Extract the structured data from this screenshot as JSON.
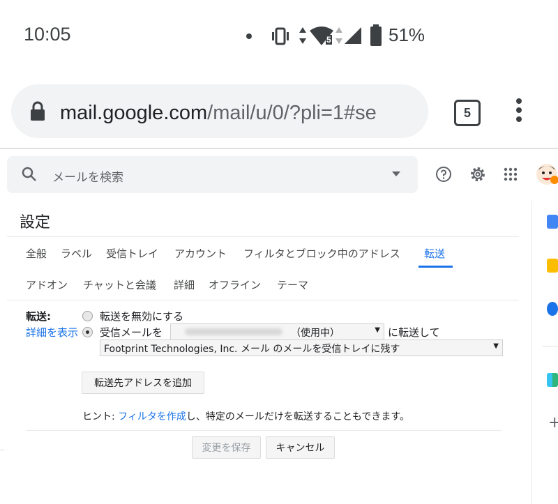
{
  "status_bar": {
    "time": "10:05",
    "battery": "51%",
    "signal_badge": "5"
  },
  "browser": {
    "url_domain": "mail.google.com",
    "url_path": "/mail/u/0/?pli=1#se",
    "tab_count": "5"
  },
  "gmail": {
    "search_placeholder": "メールを検索",
    "settings_title": "設定",
    "tabs_row1": [
      "全般",
      "ラベル",
      "受信トレイ",
      "アカウント",
      "フィルタとブロック中のアドレス",
      "転送"
    ],
    "tabs_row2": [
      "アドオン",
      "チャットと会議",
      "詳細",
      "オフライン",
      "テーマ"
    ],
    "forwarding": {
      "label": "転送:",
      "details_link": "詳細を表示",
      "option_disable": "転送を無効にする",
      "option_forward_prefix": "受信メールを",
      "address_status": "（使用中）",
      "option_forward_suffix": "に転送して",
      "keep_option": "Footprint Technologies, Inc. メール のメールを受信トレイに残す",
      "add_address_button": "転送先アドレスを追加",
      "hint_prefix": "ヒント: ",
      "hint_link": "フィルタを作成",
      "hint_suffix": "し、特定のメールだけを転送することもできます。"
    },
    "save_button": "変更を保存",
    "cancel_button": "キャンセル"
  },
  "colors": {
    "accent": "#1a73e8",
    "text": "#202124"
  }
}
